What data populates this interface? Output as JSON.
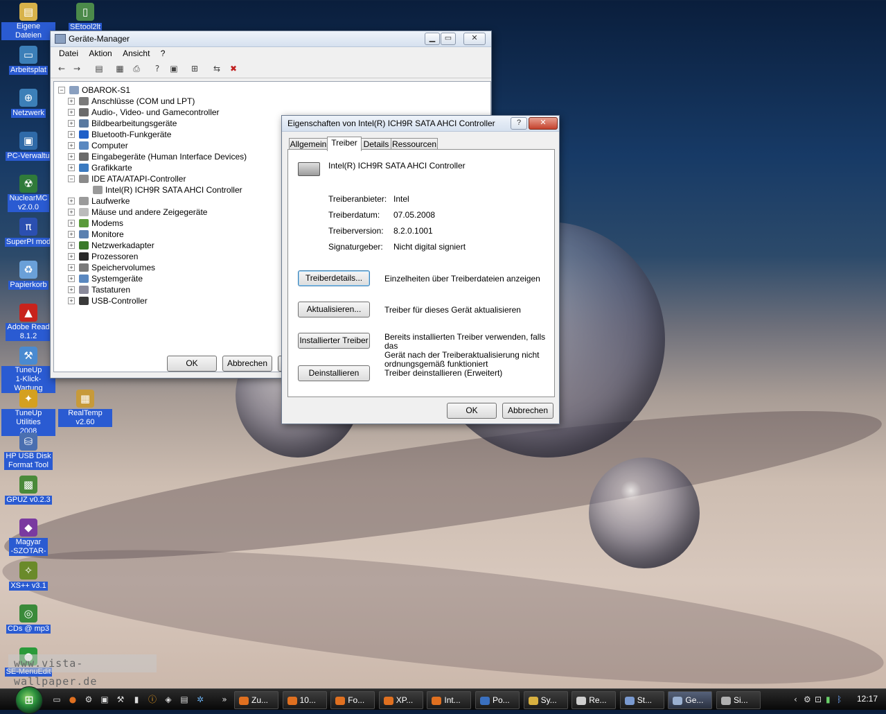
{
  "desktop": {
    "icons": [
      {
        "label": "Eigene Dateien",
        "icon": "documents-folder-icon",
        "color": "#d7b24a"
      },
      {
        "label": "SEtool2lt",
        "icon": "phone-tool-icon",
        "color": "#4b8a4a"
      },
      {
        "label": "Arbeitsplat",
        "icon": "computer-icon",
        "color": "#3c7fb8"
      },
      {
        "label": "Netzwerk",
        "icon": "network-icon",
        "color": "#3c7fb8"
      },
      {
        "label": "PC-Verwaltu",
        "icon": "pc-management-icon",
        "color": "#2f6aa8"
      },
      {
        "label": "NuclearMC\nv2.0.0",
        "icon": "nuclear-icon",
        "color": "#2f7a3a"
      },
      {
        "label": "SuperPI mod",
        "icon": "superpi-icon",
        "color": "#2b4fb0"
      },
      {
        "label": "Papierkorb",
        "icon": "recycle-bin-icon",
        "color": "#6aa0d8"
      },
      {
        "label": "Adobe Read\n8.1.2",
        "icon": "adobe-reader-icon",
        "color": "#c8231c"
      },
      {
        "label": "TuneUp\n1-Klick-Wartung",
        "icon": "tuneup-icon",
        "color": "#4a8ad0"
      },
      {
        "label": "TuneUp Utilities\n2008",
        "icon": "tuneup-utilities-icon",
        "color": "#d4a020"
      },
      {
        "label": "RealTemp v2.60",
        "icon": "realtemp-icon",
        "color": "#c79a3a"
      },
      {
        "label": "HP USB Disk\nFormat Tool",
        "icon": "usb-disk-icon",
        "color": "#4a6fb0"
      },
      {
        "label": "GPUZ v0.2.3",
        "icon": "gpuz-icon",
        "color": "#4a8a3a"
      },
      {
        "label": "Magyar\n-SZOTAR-",
        "icon": "dictionary-icon",
        "color": "#7a3aa0"
      },
      {
        "label": "XS++ v3.1",
        "icon": "xs-icon",
        "color": "#6a8a2a"
      },
      {
        "label": "CDs @ mp3",
        "icon": "cd-mp3-icon",
        "color": "#3a8a3a"
      },
      {
        "label": "SE-MenuEdit",
        "icon": "menuedit-icon",
        "color": "#2a9a3a"
      }
    ],
    "watermark": "www.vista-wallpaper.de"
  },
  "device_manager": {
    "title": "Geräte-Manager",
    "menu": [
      "Datei",
      "Aktion",
      "Ansicht",
      "?"
    ],
    "tree_root": "OBAROK-S1",
    "tree_items": [
      {
        "label": "Anschlüsse (COM und LPT)",
        "icon": "port-icon",
        "expander": "+"
      },
      {
        "label": "Audio-, Video- und Gamecontroller",
        "icon": "audio-icon",
        "expander": "+"
      },
      {
        "label": "Bildbearbeitungsgeräte",
        "icon": "imaging-icon",
        "expander": "+"
      },
      {
        "label": "Bluetooth-Funkgeräte",
        "icon": "bluetooth-icon",
        "expander": "+"
      },
      {
        "label": "Computer",
        "icon": "computer-icon",
        "expander": "+"
      },
      {
        "label": "Eingabegeräte (Human Interface Devices)",
        "icon": "hid-icon",
        "expander": "+"
      },
      {
        "label": "Grafikkarte",
        "icon": "display-adapter-icon",
        "expander": "+"
      },
      {
        "label": "IDE ATA/ATAPI-Controller",
        "icon": "ide-controller-icon",
        "expander": "−"
      },
      {
        "label": "Intel(R) ICH9R SATA AHCI Controller",
        "icon": "sata-controller-icon",
        "expander": ""
      },
      {
        "label": "Laufwerke",
        "icon": "disk-drive-icon",
        "expander": "+"
      },
      {
        "label": "Mäuse und andere Zeigegeräte",
        "icon": "mouse-icon",
        "expander": "+"
      },
      {
        "label": "Modems",
        "icon": "modem-icon",
        "expander": "+"
      },
      {
        "label": "Monitore",
        "icon": "monitor-icon",
        "expander": "+"
      },
      {
        "label": "Netzwerkadapter",
        "icon": "network-adapter-icon",
        "expander": "+"
      },
      {
        "label": "Prozessoren",
        "icon": "processor-icon",
        "expander": "+"
      },
      {
        "label": "Speichervolumes",
        "icon": "storage-volume-icon",
        "expander": "+"
      },
      {
        "label": "Systemgeräte",
        "icon": "system-device-icon",
        "expander": "+"
      },
      {
        "label": "Tastaturen",
        "icon": "keyboard-icon",
        "expander": "+"
      },
      {
        "label": "USB-Controller",
        "icon": "usb-icon",
        "expander": "+"
      }
    ],
    "ok_label": "OK",
    "cancel_label": "Abbrechen"
  },
  "properties": {
    "title": "Eigenschaften von Intel(R) ICH9R SATA AHCI Controller",
    "help_glyph": "?",
    "tabs": [
      "Allgemein",
      "Treiber",
      "Details",
      "Ressourcen"
    ],
    "device_name": "Intel(R) ICH9R SATA AHCI Controller",
    "fields": [
      {
        "label": "Treiberanbieter:",
        "value": "Intel"
      },
      {
        "label": "Treiberdatum:",
        "value": "07.05.2008"
      },
      {
        "label": "Treiberversion:",
        "value": "8.2.0.1001"
      },
      {
        "label": "Signaturgeber:",
        "value": "Nicht digital signiert"
      }
    ],
    "actions": [
      {
        "button": "Treiberdetails...",
        "description": "Einzelheiten über Treiberdateien anzeigen"
      },
      {
        "button": "Aktualisieren...",
        "description": "Treiber für dieses Gerät aktualisieren"
      },
      {
        "button": "Installierter Treiber",
        "description": "Bereits installierten Treiber verwenden, falls das\nGerät nach der Treiberaktualisierung nicht\nordnungsgemäß funktioniert"
      },
      {
        "button": "Deinstallieren",
        "description": "Treiber deinstallieren (Erweitert)"
      }
    ],
    "ok_label": "OK",
    "cancel_label": "Abbrechen"
  },
  "taskbar": {
    "buttons": [
      {
        "label": "Zu...",
        "icon": "firefox-icon",
        "color": "#e07020"
      },
      {
        "label": "10...",
        "icon": "firefox-icon",
        "color": "#e07020"
      },
      {
        "label": "Fo...",
        "icon": "firefox-icon",
        "color": "#e07020"
      },
      {
        "label": "XP...",
        "icon": "firefox-icon",
        "color": "#e07020"
      },
      {
        "label": "Int...",
        "icon": "firefox-icon",
        "color": "#e07020"
      },
      {
        "label": "Po...",
        "icon": "outlook-icon",
        "color": "#3a70c0"
      },
      {
        "label": "Sy...",
        "icon": "folder-icon",
        "color": "#d8b040"
      },
      {
        "label": "Re...",
        "icon": "document-icon",
        "color": "#cfcfcf"
      },
      {
        "label": "St...",
        "icon": "settings-icon",
        "color": "#7a9ad0"
      },
      {
        "label": "Ge...",
        "icon": "device-manager-icon",
        "color": "#9ab0d0"
      },
      {
        "label": "Si...",
        "icon": "system-icon",
        "color": "#b0b0b0"
      }
    ],
    "tray_time": "12:17"
  }
}
